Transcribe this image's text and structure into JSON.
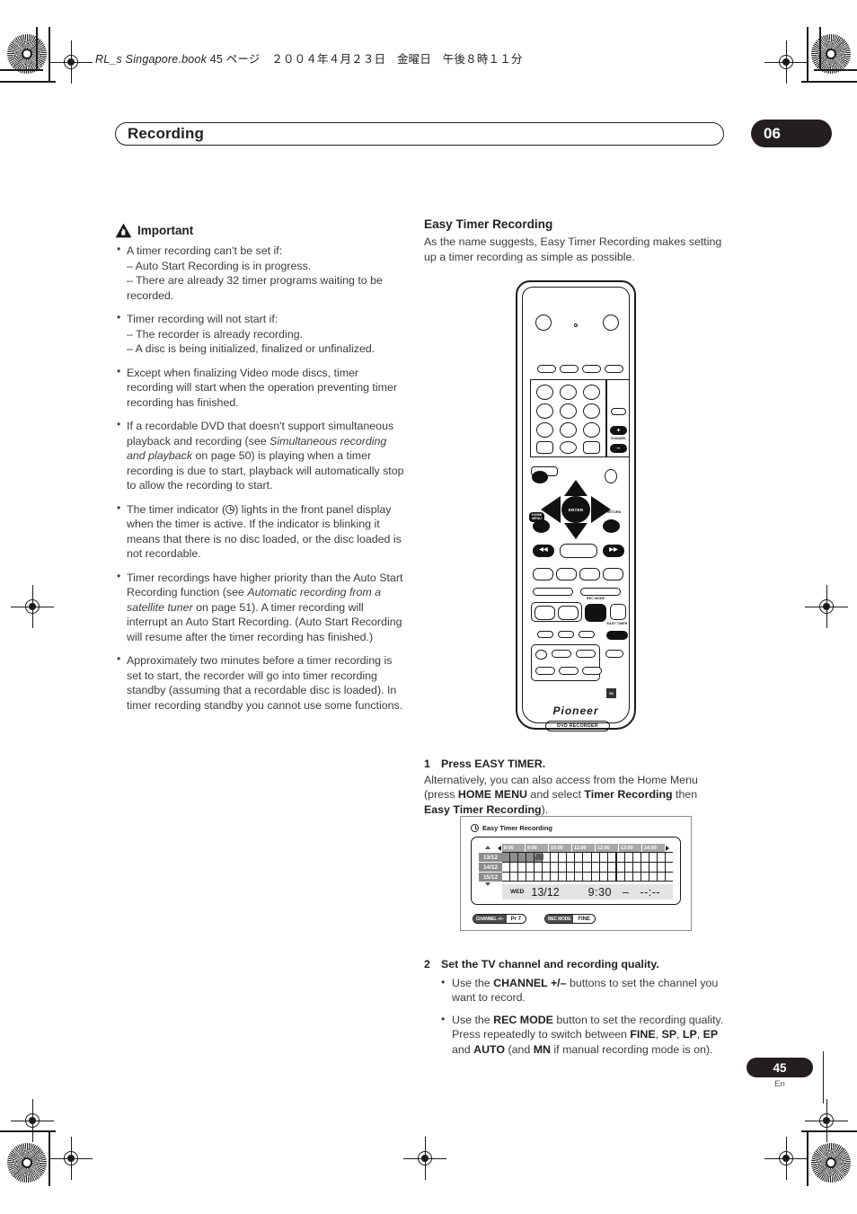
{
  "running_head": {
    "book": "RL_s Singapore.book",
    "rest": "45 ページ　２００４年４月２３日　金曜日　午後８時１１分"
  },
  "header": {
    "chapter_title": "Recording",
    "chapter_number": "06"
  },
  "left_column": {
    "important_label": "Important",
    "bullets": [
      {
        "main": "A timer recording can't be set if:",
        "subs": [
          "– Auto Start Recording is in progress.",
          "– There are already 32 timer programs waiting to be recorded."
        ]
      },
      {
        "main": "Timer recording will not start if:",
        "subs": [
          "– The recorder is already recording.",
          "– A disc is being initialized, finalized or unfinalized."
        ]
      },
      {
        "main": "Except when finalizing Video mode discs, timer recording will start when the operation preventing timer recording has finished.",
        "subs": []
      }
    ],
    "bullet_dvd_pre": "If a recordable DVD that doesn't support simultaneous playback and recording (see ",
    "bullet_dvd_italic": "Simultaneous recording and playback",
    "bullet_dvd_post": " on page 50) is playing when a timer recording is due to start, playback will automatically stop to allow the recording to start.",
    "bullet_indicator_pre": "The timer indicator (",
    "bullet_indicator_post": ") lights in the front panel display when the timer is active. If the indicator is blinking it means that there is no disc loaded, or the disc loaded is not recordable.",
    "bullet_priority_pre": "Timer recordings have higher priority than the Auto Start Recording function (see ",
    "bullet_priority_italic": "Automatic recording from a satellite tuner",
    "bullet_priority_post": " on page 51). A timer recording will interrupt an Auto Start Recording. (Auto Start Recording will resume after the timer recording has finished.)",
    "bullet_standby": "Approximately two minutes before a timer recording is set to start, the recorder will go into timer recording standby (assuming that a recordable disc is loaded). In timer recording standby you cannot use some functions."
  },
  "right_column": {
    "section_title": "Easy Timer Recording",
    "section_intro": "As the name suggests, Easy Timer Recording makes setting up a timer recording as simple as possible.",
    "step1": {
      "num": "1",
      "head": "Press EASY TIMER.",
      "pre": "Alternatively, you can also access from the Home Menu (press ",
      "b1": "HOME MENU",
      "mid1": " and select ",
      "b2": "Timer Recording",
      "mid2": " then ",
      "b3": "Easy Timer Recording",
      "post": ")."
    },
    "step2": {
      "num": "2",
      "head": "Set the TV channel and recording quality.",
      "b1_pre": "Use the ",
      "b1_bold": "CHANNEL +/–",
      "b1_post": " buttons to set the channel you want to record.",
      "b2_pre": "Use the ",
      "b2_bold": "REC MODE",
      "b2_mid": " button to set the recording quality. Press repeatedly to switch between ",
      "b2_m1": "FINE",
      "b2_m2": "SP",
      "b2_m3": "LP",
      "b2_m4": "EP",
      "b2_and": " and ",
      "b2_m5": "AUTO",
      "b2_paren_pre": " (and ",
      "b2_m6": "MN",
      "b2_post": " if manual recording mode is on)."
    }
  },
  "remote": {
    "labels": {
      "channel": "CHANNEL",
      "plus": "+",
      "minus": "–",
      "enter": "ENTER",
      "home_menu": "HOME MENU",
      "return": "RETURN",
      "rec_mode": "REC MODE",
      "easy_timer": "EASY TIMER",
      "rev": "◀◀",
      "fwd": "▶▶",
      "brand": "Pioneer",
      "product": "DVD RECORDER",
      "badge": "53"
    }
  },
  "osd": {
    "title": "Easy Timer Recording",
    "time_headers": [
      "8:00",
      "9:00",
      "10:00",
      "11:00",
      "12:00",
      "13:00",
      "14:00"
    ],
    "date_rows": [
      "13/12",
      "14/12",
      "15/12"
    ],
    "shaded_cells_row1": [
      0,
      1,
      2,
      3,
      4
    ],
    "info": {
      "day_of_week": "WED",
      "date": "13/12",
      "start_time": "9:30",
      "dash": "–",
      "end_time": "--:--"
    },
    "footer_tags": [
      {
        "key": "CHANNEL +/–",
        "value": "Pr 7"
      },
      {
        "key": "REC MODE",
        "value": "FINE"
      }
    ]
  },
  "footer": {
    "page_number": "45",
    "language": "En"
  },
  "colors": {
    "ink": "#231f20",
    "body_text": "#3b3b3b",
    "osd_header_gray": "#a8a8a8",
    "osd_label_gray": "#8d8d8d"
  }
}
